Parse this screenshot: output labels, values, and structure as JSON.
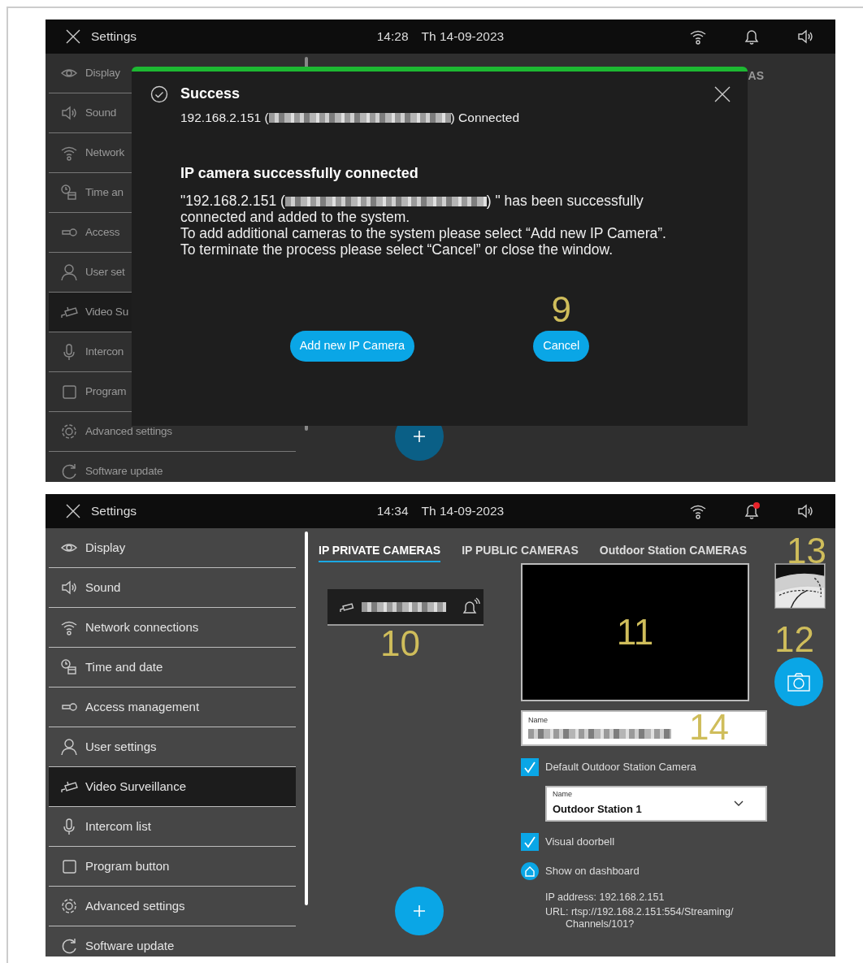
{
  "screens": [
    {
      "header": {
        "title": "Settings",
        "time": "14:28",
        "date": "Th 14-09-2023",
        "notification": false
      },
      "sidebar": [
        {
          "label": "Display",
          "selected": false
        },
        {
          "label": "Sound",
          "selected": false
        },
        {
          "label": "Network",
          "selected": false
        },
        {
          "label": "Time an",
          "selected": false
        },
        {
          "label": "Access",
          "selected": false
        },
        {
          "label": "User set",
          "selected": false
        },
        {
          "label": "Video Su",
          "selected": true
        },
        {
          "label": "Intercon",
          "selected": false
        },
        {
          "label": "Program",
          "selected": false
        },
        {
          "label": "Advanced settings",
          "selected": false
        },
        {
          "label": "Software update",
          "selected": false
        }
      ],
      "tabs": [
        {
          "label": "AS",
          "selected": false
        }
      ],
      "dialog": {
        "title": "Success",
        "ip_before": "192.168.2.151 (",
        "ip_after": ") Connected",
        "heading": "IP camera successfully connected",
        "message_before": "\"192.168.2.151 (",
        "message_after": ") \" has been successfully connected and added to the system.",
        "lines": [
          "To add additional cameras to the system please select “Add new IP Camera”.",
          "To terminate the process please select “Cancel” or close the window."
        ],
        "buttons": [
          "Add new IP Camera",
          "Cancel"
        ],
        "annotation": "9"
      }
    },
    {
      "header": {
        "title": "Settings",
        "time": "14:34",
        "date": "Th 14-09-2023",
        "notification": true
      },
      "sidebar": [
        {
          "label": "Display",
          "selected": false
        },
        {
          "label": "Sound",
          "selected": false
        },
        {
          "label": "Network connections",
          "selected": false
        },
        {
          "label": "Time and date",
          "selected": false
        },
        {
          "label": "Access  management",
          "selected": false
        },
        {
          "label": "User settings",
          "selected": false
        },
        {
          "label": "Video Surveillance",
          "selected": true
        },
        {
          "label": "Intercom list",
          "selected": false
        },
        {
          "label": "Program button",
          "selected": false
        },
        {
          "label": "Advanced settings",
          "selected": false
        },
        {
          "label": "Software update",
          "selected": false
        }
      ],
      "tabs": [
        {
          "label": "IP PRIVATE CAMERAS",
          "selected": true
        },
        {
          "label": "IP PUBLIC CAMERAS",
          "selected": false
        },
        {
          "label": "Outdoor Station CAMERAS",
          "selected": false
        }
      ],
      "camera_list": {
        "annotation": "10"
      },
      "preview": {
        "annotation": "11"
      },
      "name_field": {
        "label": "Name",
        "annotation": "14"
      },
      "options": [
        {
          "kind": "checkbox",
          "label": "Default Outdoor Station Camera",
          "checked": true
        },
        {
          "kind": "dropdown",
          "label": "Name",
          "value": "Outdoor Station 1"
        },
        {
          "kind": "checkbox",
          "label": "Visual doorbell",
          "checked": true
        },
        {
          "kind": "toggle",
          "label": "Show on dashboard",
          "checked": true
        }
      ],
      "info": {
        "ip": "IP address: 192.168.2.151",
        "url_lines": [
          "URL: rtsp://192.168.2.151:554/Streaming/",
          "Channels/101?"
        ]
      },
      "thumbnail": {
        "kind": "picture",
        "annotation": "13"
      },
      "snapshot_button": {
        "annotation": "12"
      }
    }
  ]
}
